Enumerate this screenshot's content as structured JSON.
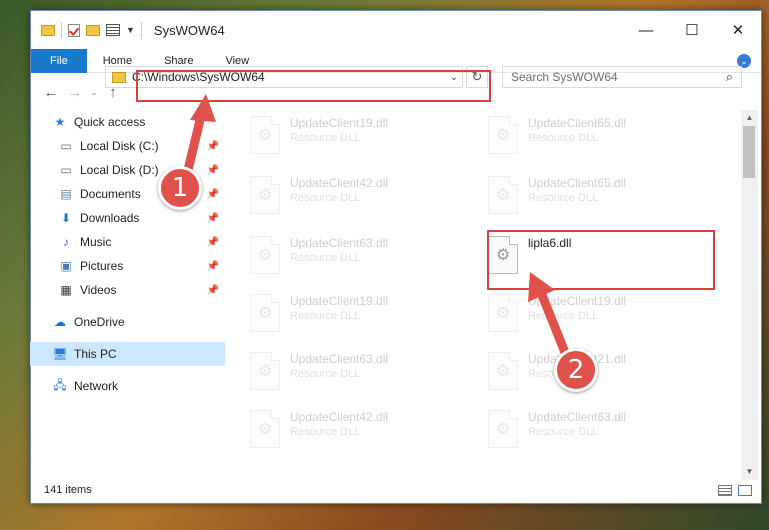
{
  "window": {
    "title": "SysWOW64",
    "controls": {
      "minimize": "—",
      "maximize": "☐",
      "close": "✕"
    }
  },
  "ribbon": {
    "tabs": [
      "File",
      "Home",
      "Share",
      "View"
    ]
  },
  "address": {
    "path": "C:\\Windows\\SysWOW64"
  },
  "search": {
    "placeholder": "Search SysWOW64"
  },
  "sidebar": {
    "items": [
      {
        "label": "Quick access",
        "icon": "star-icon",
        "pinned": false
      },
      {
        "label": "Local Disk (C:)",
        "icon": "drive-icon",
        "pinned": true
      },
      {
        "label": "Local Disk (D:)",
        "icon": "drive-icon",
        "pinned": true
      },
      {
        "label": "Documents",
        "icon": "documents-icon",
        "pinned": true
      },
      {
        "label": "Downloads",
        "icon": "download-icon",
        "pinned": true
      },
      {
        "label": "Music",
        "icon": "music-icon",
        "pinned": true
      },
      {
        "label": "Pictures",
        "icon": "pictures-icon",
        "pinned": true
      },
      {
        "label": "Videos",
        "icon": "videos-icon",
        "pinned": true
      },
      {
        "label": "OneDrive",
        "icon": "cloud-icon"
      },
      {
        "label": "This PC",
        "icon": "computer-icon",
        "selected": true
      },
      {
        "label": "Network",
        "icon": "network-icon"
      }
    ]
  },
  "files": {
    "left_column": [
      {
        "name": "UpdateClient19.dll",
        "type": "Resource DLL"
      },
      {
        "name": "UpdateClient42.dll",
        "type": "Resource DLL"
      },
      {
        "name": "UpdateClient63.dll",
        "type": "Resource DLL"
      },
      {
        "name": "UpdateClient19.dll",
        "type": "Resource DLL"
      },
      {
        "name": "UpdateClient63.dll",
        "type": "Resource DLL"
      },
      {
        "name": "UpdateClient42.dll",
        "type": "Resource DLL"
      }
    ],
    "right_column": [
      {
        "name": "UpdateClient65.dll",
        "type": "Resource DLL"
      },
      {
        "name": "UpdateClient65.dll",
        "type": "Resource DLL"
      },
      {
        "name": "lipla6.dll",
        "type": ""
      },
      {
        "name": "UpdateClient19.dll",
        "type": "Resource DLL"
      },
      {
        "name": "UpdateClient21.dll",
        "type": "Resource DLL"
      },
      {
        "name": "UpdateClient63.dll",
        "type": "Resource DLL"
      }
    ]
  },
  "status": {
    "item_count": "141 items"
  },
  "markers": {
    "one": "1",
    "two": "2"
  },
  "colors": {
    "highlight": "#d9403a",
    "marker": "#e0514b",
    "file_tab": "#1979ca",
    "selected": "#cce8ff"
  }
}
